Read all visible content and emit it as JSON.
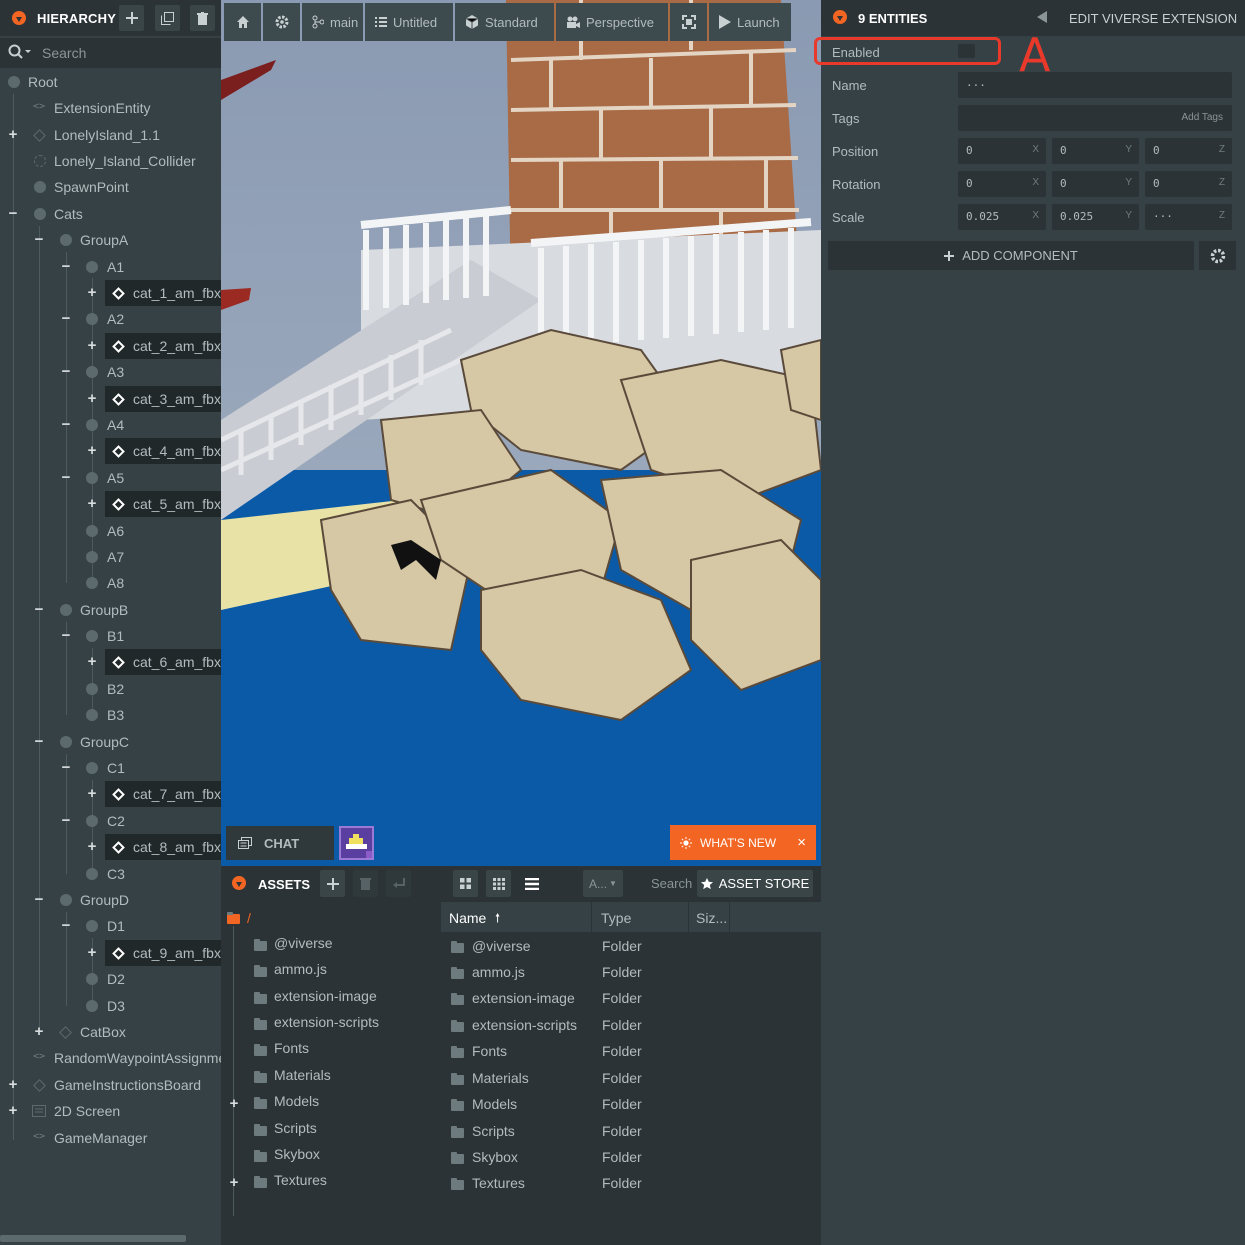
{
  "hierarchy": {
    "title": "HIERARCHY",
    "search_placeholder": "Search",
    "nodes": [
      {
        "label": "Root"
      },
      {
        "label": "ExtensionEntity"
      },
      {
        "label": "LonelyIsland_1.1"
      },
      {
        "label": "Lonely_Island_Collider"
      },
      {
        "label": "SpawnPoint"
      },
      {
        "label": "Cats"
      },
      {
        "label": "GroupA"
      },
      {
        "label": "A1"
      },
      {
        "label": "cat_1_am_fbx"
      },
      {
        "label": "A2"
      },
      {
        "label": "cat_2_am_fbx"
      },
      {
        "label": "A3"
      },
      {
        "label": "cat_3_am_fbx"
      },
      {
        "label": "A4"
      },
      {
        "label": "cat_4_am_fbx"
      },
      {
        "label": "A5"
      },
      {
        "label": "cat_5_am_fbx"
      },
      {
        "label": "A6"
      },
      {
        "label": "A7"
      },
      {
        "label": "A8"
      },
      {
        "label": "GroupB"
      },
      {
        "label": "B1"
      },
      {
        "label": "cat_6_am_fbx"
      },
      {
        "label": "B2"
      },
      {
        "label": "B3"
      },
      {
        "label": "GroupC"
      },
      {
        "label": "C1"
      },
      {
        "label": "cat_7_am_fbx"
      },
      {
        "label": "C2"
      },
      {
        "label": "cat_8_am_fbx"
      },
      {
        "label": "C3"
      },
      {
        "label": "GroupD"
      },
      {
        "label": "D1"
      },
      {
        "label": "cat_9_am_fbx"
      },
      {
        "label": "D2"
      },
      {
        "label": "D3"
      },
      {
        "label": "CatBox"
      },
      {
        "label": "RandomWaypointAssignment"
      },
      {
        "label": "GameInstructionsBoard"
      },
      {
        "label": "2D Screen"
      },
      {
        "label": "GameManager"
      }
    ]
  },
  "viewport": {
    "toolbar": {
      "branch": "main",
      "scene": "Untitled",
      "render_mode": "Standard",
      "camera": "Perspective",
      "launch": "Launch"
    },
    "chat_label": "CHAT",
    "whats_new_label": "WHAT'S NEW",
    "whats_new_close": "×"
  },
  "assets": {
    "title": "ASSETS",
    "filter_label": "A...",
    "search_placeholder": "Search",
    "store_label": "ASSET STORE",
    "root_path": "/",
    "columns": {
      "name": "Name",
      "type": "Type",
      "size": "Siz..."
    },
    "folders": [
      "@viverse",
      "ammo.js",
      "extension-image",
      "extension-scripts",
      "Fonts",
      "Materials",
      "Models",
      "Scripts",
      "Skybox",
      "Textures"
    ],
    "rows": [
      {
        "name": "@viverse",
        "type": "Folder"
      },
      {
        "name": "ammo.js",
        "type": "Folder"
      },
      {
        "name": "extension-image",
        "type": "Folder"
      },
      {
        "name": "extension-scripts",
        "type": "Folder"
      },
      {
        "name": "Fonts",
        "type": "Folder"
      },
      {
        "name": "Materials",
        "type": "Folder"
      },
      {
        "name": "Models",
        "type": "Folder"
      },
      {
        "name": "Scripts",
        "type": "Folder"
      },
      {
        "name": "Skybox",
        "type": "Folder"
      },
      {
        "name": "Textures",
        "type": "Folder"
      }
    ]
  },
  "inspector": {
    "title": "9 ENTITIES",
    "action": "EDIT VIVERSE EXTENSION",
    "enabled_label": "Enabled",
    "name_label": "Name",
    "name_value": "...",
    "tags_label": "Tags",
    "tags_add": "Add Tags",
    "position_label": "Position",
    "position": [
      "0",
      "0",
      "0"
    ],
    "rotation_label": "Rotation",
    "rotation": [
      "0",
      "0",
      "0"
    ],
    "scale_label": "Scale",
    "scale": [
      "0.025",
      "0.025",
      "..."
    ],
    "axes": [
      "X",
      "Y",
      "Z"
    ],
    "add_component": "ADD COMPONENT"
  },
  "annotation": {
    "letter": "A"
  }
}
